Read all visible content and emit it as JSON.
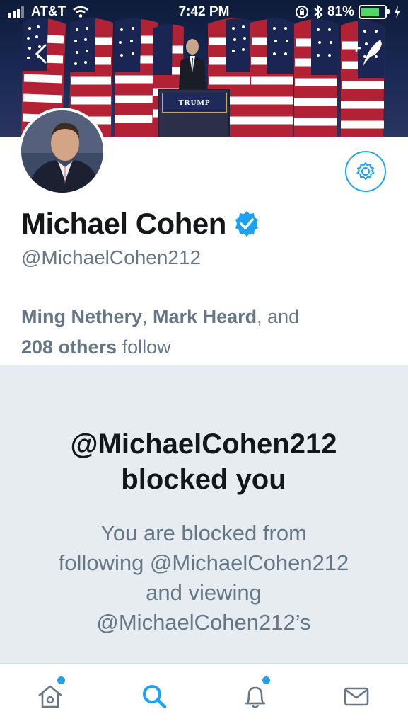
{
  "status_bar": {
    "carrier": "AT&T",
    "time": "7:42 PM",
    "battery_percent": "81%",
    "battery_level": 0.81
  },
  "banner": {
    "podium_sign": "TRUMP"
  },
  "profile": {
    "name": "Michael Cohen",
    "handle": "@MichaelCohen212",
    "followed_by": {
      "name1": "Ming Nethery",
      "sep1": ", ",
      "name2": "Mark Heard",
      "sep2": ", and",
      "others": "208 others",
      "suffix": " follow"
    }
  },
  "blocked": {
    "title": "@MichaelCohen212 blocked you",
    "description": "You are blocked from following @MichaelCohen212 and viewing @MichaelCohen212’s"
  },
  "colors": {
    "accent": "#1da1f2",
    "text_primary": "#14171a",
    "text_secondary": "#657786",
    "blocked_bg": "#e6ecf0"
  },
  "tab_icons": [
    "home-icon",
    "search-icon",
    "notifications-icon",
    "messages-icon"
  ]
}
